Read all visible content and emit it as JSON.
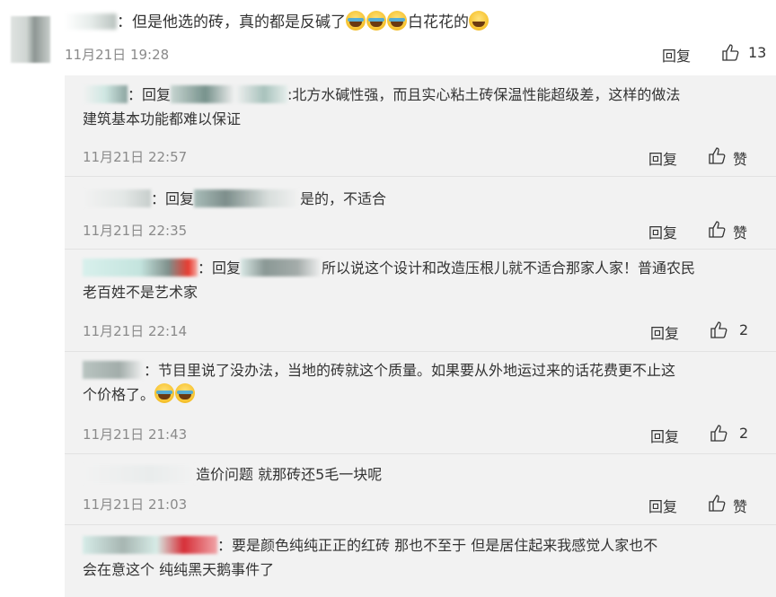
{
  "main_comment": {
    "text": "：但是他选的砖，真的都是反碱了",
    "text_tail": "白花花的",
    "time": "11月21日 19:28",
    "reply_label": "回复",
    "like_count": "13"
  },
  "replies": [
    {
      "prefix": "：回复",
      "text": ":北方水碱性强，而且实心粘土砖保温性能超级差，这样的做法",
      "text2": "建筑基本功能都难以保证",
      "time": "11月21日 22:57",
      "reply_label": "回复",
      "like": "赞"
    },
    {
      "prefix": "：回复",
      "text": "是的，不适合",
      "time": "11月21日 22:35",
      "reply_label": "回复",
      "like": "赞"
    },
    {
      "prefix": "：回复",
      "text": "所以说这个设计和改造压根儿就不适合那家人家！普通农民",
      "text2": "老百姓不是艺术家",
      "time": "11月21日 22:14",
      "reply_label": "回复",
      "like": "2"
    },
    {
      "prefix": "：",
      "text": "节目里说了没办法，当地的砖就这个质量。如果要从外地运过来的话花费更不止这",
      "text2": "个价格了。",
      "time": "11月21日 21:43",
      "reply_label": "回复",
      "like": "2"
    },
    {
      "prefix": "",
      "text": "造价问题 就那砖还5毛一块呢",
      "time": "11月21日 21:03",
      "reply_label": "回复",
      "like": "赞"
    },
    {
      "prefix": "：",
      "text": "要是颜色纯纯正正的红砖    那也不至于    但是居住起来我感觉人家也不",
      "text2": "会在意这个    纯纯黑天鹅事件了"
    }
  ]
}
